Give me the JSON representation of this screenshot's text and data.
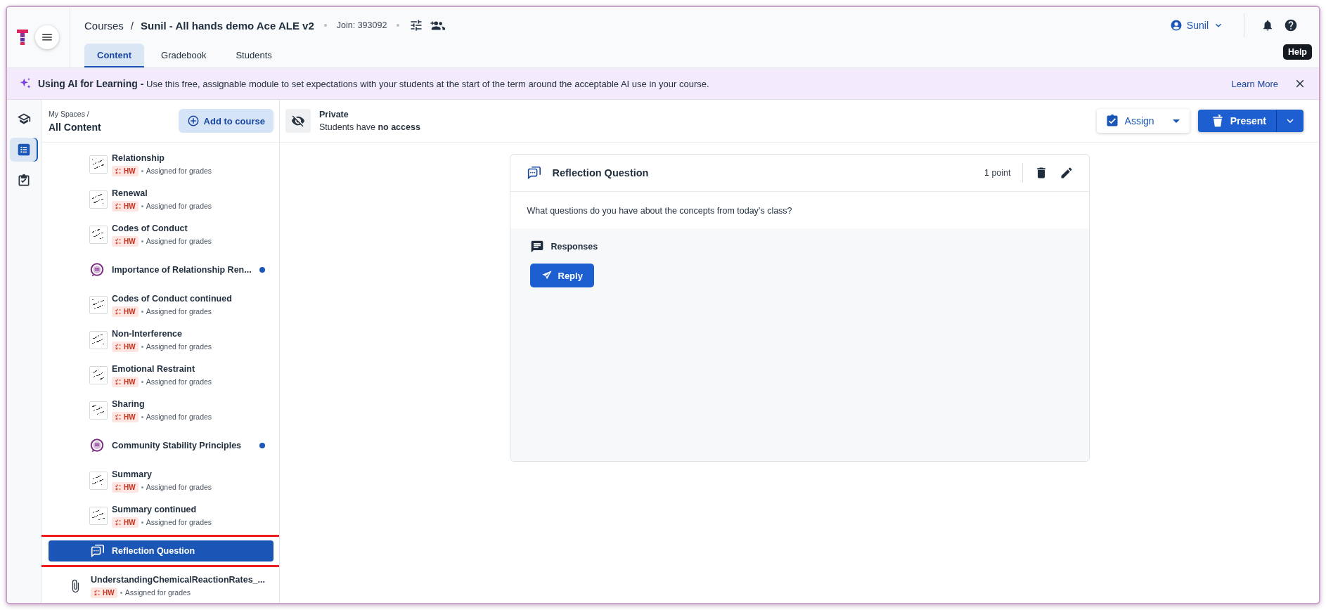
{
  "header": {
    "breadcrumb_root": "Courses",
    "separator": "/",
    "course_title": "Sunil - All hands demo Ace ALE v2",
    "join_code": "Join: 393092",
    "user": "Sunil",
    "tooltip": "Help"
  },
  "tabs": [
    {
      "label": "Content",
      "selected": true
    },
    {
      "label": "Gradebook",
      "selected": false
    },
    {
      "label": "Students",
      "selected": false
    }
  ],
  "banner": {
    "text": "**Using AI for Learning -** Use this free, assignable module to set expectations with your students at the start of the term around the acceptable AI use in your course.",
    "link": "Learn More"
  },
  "rail": [
    {
      "kind": "courses",
      "selected": false
    },
    {
      "kind": "content",
      "selected": true
    },
    {
      "kind": "assignments",
      "selected": false
    }
  ],
  "sidebar": {
    "breadcrumb": "My Spaces /",
    "title": "All Content",
    "add_button": "Add to course",
    "items": [
      {
        "kind": "worksheet",
        "title": "Relationship",
        "badge": "HW",
        "status": "Assigned for grades",
        "unread": false,
        "selected": false,
        "highlighted": false
      },
      {
        "kind": "worksheet",
        "title": "Renewal",
        "badge": "HW",
        "status": "Assigned for grades",
        "unread": false,
        "selected": false,
        "highlighted": false
      },
      {
        "kind": "worksheet",
        "title": "Codes of Conduct",
        "badge": "HW",
        "status": "Assigned for grades",
        "unread": false,
        "selected": false,
        "highlighted": false
      },
      {
        "kind": "discussion",
        "title": "Importance of Relationship Ren...",
        "unread": true,
        "selected": false,
        "highlighted": false
      },
      {
        "kind": "worksheet",
        "title": "Codes of Conduct continued",
        "badge": "HW",
        "status": "Assigned for grades",
        "unread": false,
        "selected": false,
        "highlighted": false
      },
      {
        "kind": "worksheet",
        "title": "Non-Interference",
        "badge": "HW",
        "status": "Assigned for grades",
        "unread": false,
        "selected": false,
        "highlighted": false
      },
      {
        "kind": "worksheet",
        "title": "Emotional Restraint",
        "badge": "HW",
        "status": "Assigned for grades",
        "unread": false,
        "selected": false,
        "highlighted": false
      },
      {
        "kind": "worksheet",
        "title": "Sharing",
        "badge": "HW",
        "status": "Assigned for grades",
        "unread": false,
        "selected": false,
        "highlighted": false
      },
      {
        "kind": "discussion",
        "title": "Community Stability Principles",
        "unread": true,
        "selected": false,
        "highlighted": false
      },
      {
        "kind": "worksheet",
        "title": "Summary",
        "badge": "HW",
        "status": "Assigned for grades",
        "unread": false,
        "selected": false,
        "highlighted": false
      },
      {
        "kind": "worksheet",
        "title": "Summary continued",
        "badge": "HW",
        "status": "Assigned for grades",
        "unread": false,
        "selected": false,
        "highlighted": false
      },
      {
        "kind": "reflection",
        "title": "Reflection Question",
        "unread": false,
        "selected": true,
        "highlighted": true
      },
      {
        "kind": "file",
        "title": "UnderstandingChemicalReactionRates_...",
        "badge": "HW",
        "status": "Assigned for grades",
        "unread": false,
        "selected": false,
        "highlighted": false
      }
    ]
  },
  "toolbar": {
    "visibility": "Private",
    "access_note": "Students have **no access**",
    "assign_button": "Assign",
    "present_button": "Present"
  },
  "card": {
    "title": "Reflection Question",
    "points": "1 point",
    "question": "What questions do you have about the concepts from today’s class?",
    "responses_label": "Responses",
    "reply_button": "Reply"
  }
}
